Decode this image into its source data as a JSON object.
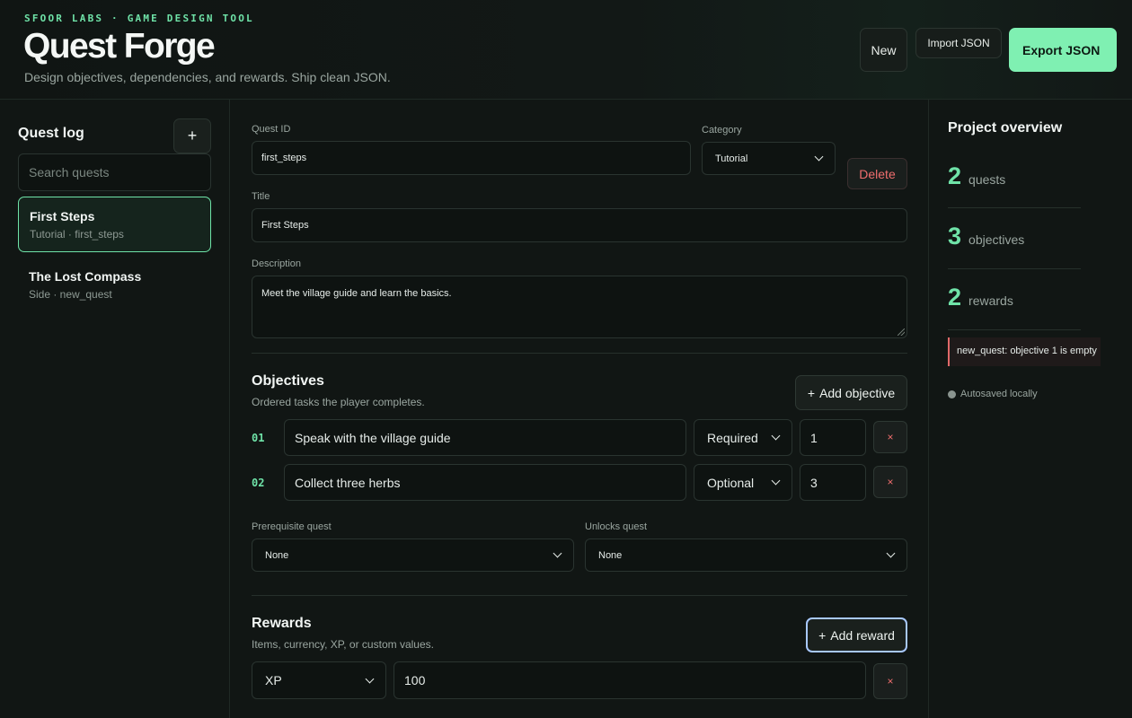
{
  "header": {
    "brand": "SFOOR LABS · GAME DESIGN TOOL",
    "title": "Quest Forge",
    "subtitle": "Design objectives, dependencies, and rewards. Ship clean JSON.",
    "buttons": {
      "new": "New",
      "import": "Import JSON",
      "export": "Export JSON"
    }
  },
  "sidebar": {
    "title": "Quest log",
    "add_label": "+",
    "search_placeholder": "Search quests",
    "quests": [
      {
        "name": "First Steps",
        "meta": "Tutorial · first_steps",
        "active": true
      },
      {
        "name": "The Lost Compass",
        "meta": "Side · new_quest",
        "active": false
      }
    ]
  },
  "editor": {
    "quest_id_label": "Quest ID",
    "quest_id_value": "first_steps",
    "category_label": "Category",
    "category_value": "Tutorial",
    "delete_label": "Delete",
    "title_label": "Title",
    "title_value": "First Steps",
    "description_label": "Description",
    "description_value": "Meet the village guide and learn the basics.",
    "objectives": {
      "title": "Objectives",
      "subtitle": "Ordered tasks the player completes.",
      "add_label": "Add objective",
      "items": [
        {
          "num": "01",
          "text": "Speak with the village guide",
          "type": "Required",
          "count": "1",
          "remove": "×"
        },
        {
          "num": "02",
          "text": "Collect three herbs",
          "type": "Optional",
          "count": "3",
          "remove": "×"
        }
      ]
    },
    "prerequisite_label": "Prerequisite quest",
    "prerequisite_value": "None",
    "unlocks_label": "Unlocks quest",
    "unlocks_value": "None",
    "rewards": {
      "title": "Rewards",
      "subtitle": "Items, currency, XP, or custom values.",
      "add_label": "Add reward",
      "items": [
        {
          "type": "XP",
          "value": "100",
          "remove": "×"
        }
      ]
    }
  },
  "overview": {
    "title": "Project overview",
    "stats": [
      {
        "value": "2",
        "label": "quests"
      },
      {
        "value": "3",
        "label": "objectives"
      },
      {
        "value": "2",
        "label": "rewards"
      }
    ],
    "warning": "new_quest: objective 1 is empty",
    "autosave": "Autosaved locally"
  },
  "colors": {
    "accent": "#6fe3a8",
    "danger": "#f06e6e",
    "background": "#111614"
  }
}
